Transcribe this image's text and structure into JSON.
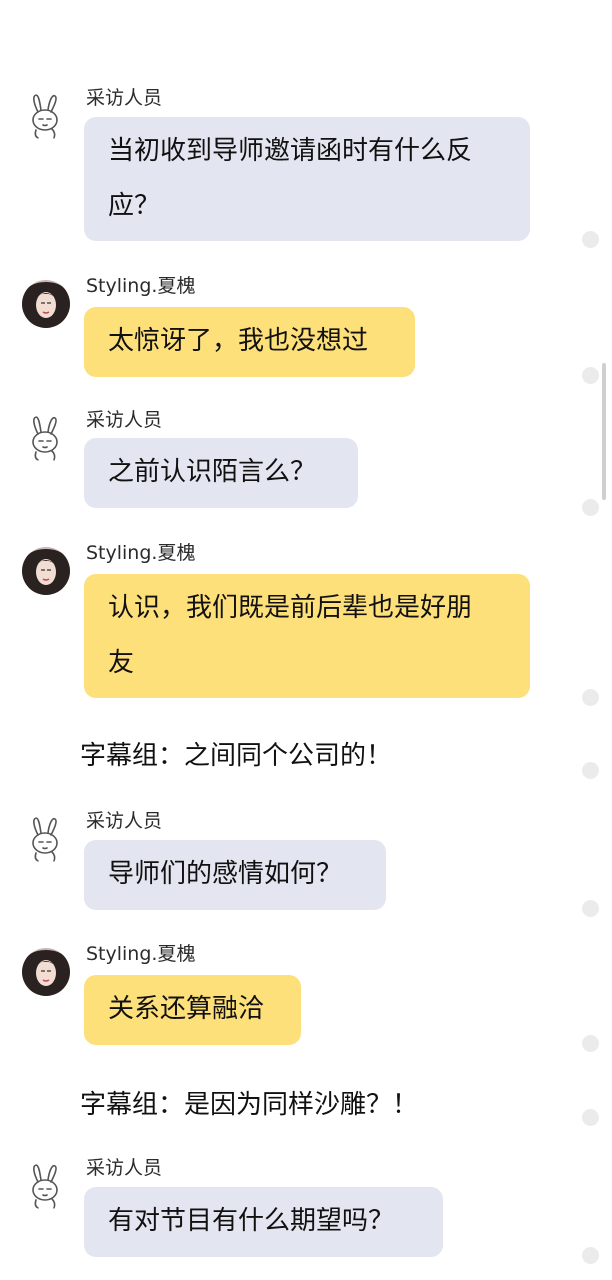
{
  "speakers": {
    "interviewer": "采访人员",
    "guest": "Styling.夏槐"
  },
  "messages": [
    {
      "text_lines": [
        "当初收到导师邀请函时有什么反",
        "应？"
      ]
    },
    {
      "text_lines": [
        "太惊讶了，我也没想过"
      ]
    },
    {
      "text_lines": [
        "之前认识陌言么？"
      ]
    },
    {
      "text_lines": [
        "认识，我们既是前后辈也是好朋",
        "友"
      ]
    },
    {
      "text": "字幕组：之间同个公司的！"
    },
    {
      "text_lines": [
        "导师们的感情如何？"
      ]
    },
    {
      "text_lines": [
        "关系还算融洽"
      ]
    },
    {
      "text": "字幕组：是因为同样沙雕？！"
    },
    {
      "text_lines": [
        "有对节目有什么期望吗？"
      ]
    }
  ],
  "icons": {
    "interviewer_avatar": "rabbit-doodle-icon",
    "guest_avatar": "woman-photo-avatar"
  }
}
